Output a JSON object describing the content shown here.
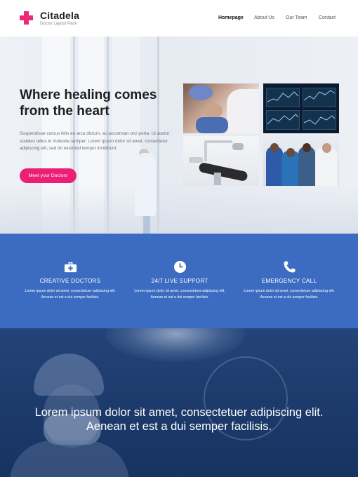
{
  "brand": {
    "name": "Citadela",
    "tagline": "Doctor Layout Pack",
    "accent_color": "#ec2a7a"
  },
  "nav": {
    "items": [
      "Homepage",
      "About Us",
      "Our Team",
      "Contact"
    ],
    "active": "Homepage"
  },
  "hero": {
    "title_line1": "Where healing comes",
    "title_line2": "from the heart",
    "text": "Suspendisse cursus felis eu arcu dictum, eu accumsan orci porta. Ut auctor sodales tellus in molestie semper. Lorem ipsum dolor sit amet, consectetur adipiscing elit, sed do eiusmod tempor incididunt.",
    "cta_label": "Meet your Doctors",
    "cta_color": "#ec1f77",
    "photos": [
      "dentist-photo",
      "monitor-photo",
      "dental-chair-photo",
      "doctors-photo"
    ]
  },
  "features": {
    "background": "#3c6cc2",
    "items": [
      {
        "icon": "first-aid-kit-icon",
        "title": "CREATIVE DOCTORS",
        "text": "Lorem ipsum dolor sit amet, consectetuer adipiscing elit. Aenean et est a dui semper facilisis."
      },
      {
        "icon": "clock-icon",
        "title": "24/7 LIVE SUPPORT",
        "text": "Lorem ipsum dolor sit amet, consectetuer adipiscing elit. Aenean et est a dui semper facilisis."
      },
      {
        "icon": "phone-icon",
        "title": "EMERGENCY CALL",
        "text": "Lorem ipsum dolor sit amet, consectetuer adipiscing elit. Aenean et est a dui semper facilisis."
      }
    ]
  },
  "quote": {
    "line1": "Lorem ipsum dolor sit amet, consectetuer adipiscing elit.",
    "line2": "Aenean et est a dui semper facilisis."
  }
}
